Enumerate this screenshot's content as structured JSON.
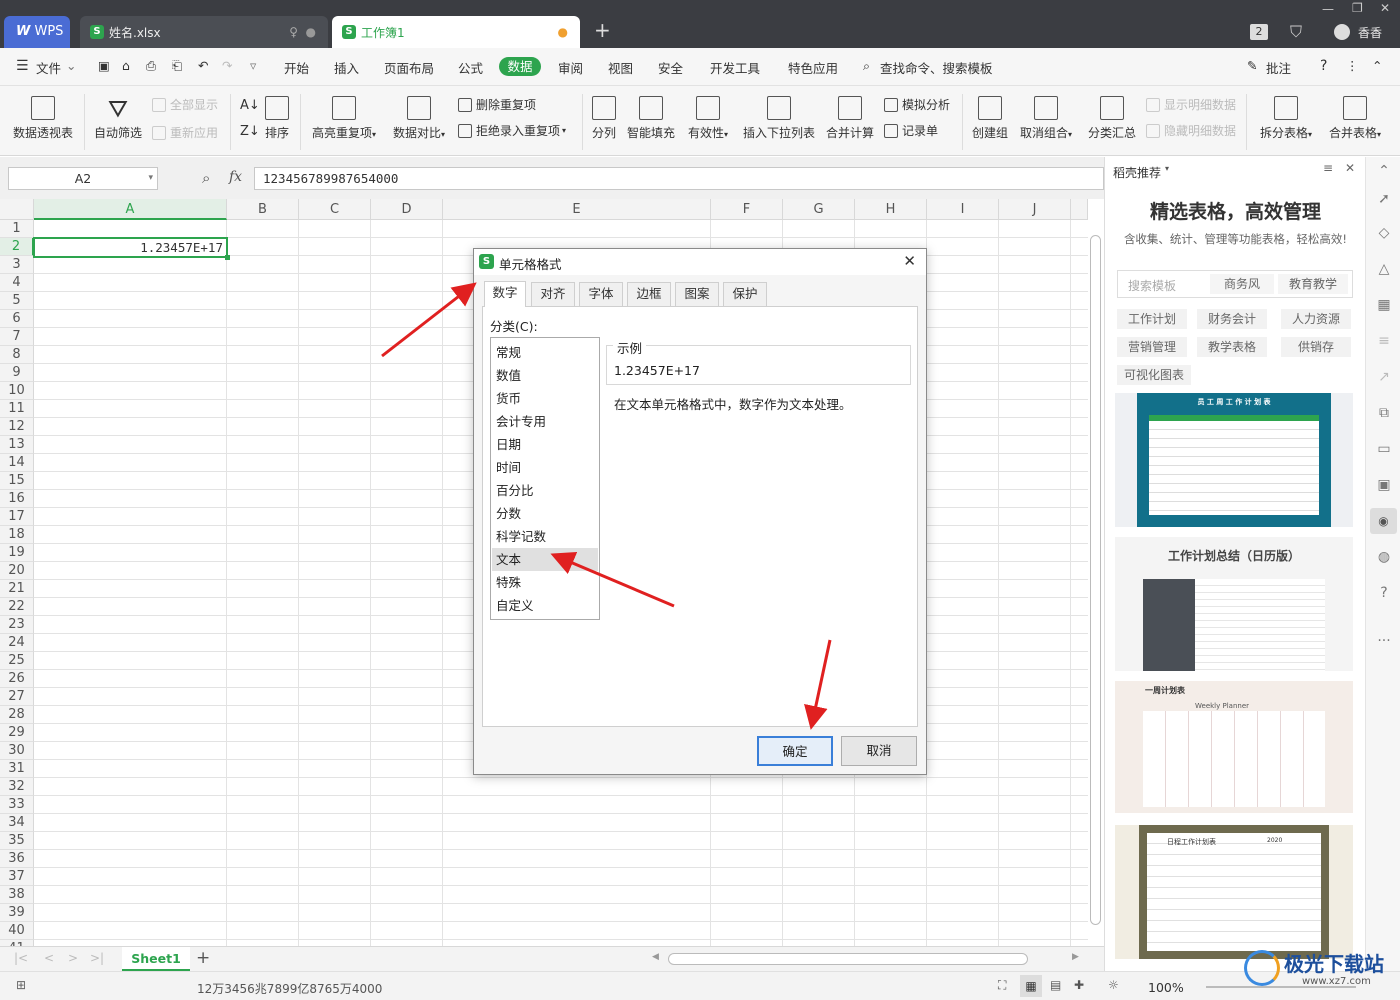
{
  "titlebar": {
    "app_label": "WPS",
    "tabs": [
      {
        "label": "姓名.xlsx"
      },
      {
        "label": "工作簿1"
      }
    ],
    "new_tab": "+",
    "page_count": "2",
    "user_name": "香香"
  },
  "menu": {
    "file": "文件",
    "items": [
      "开始",
      "插入",
      "页面布局",
      "公式",
      "数据",
      "审阅",
      "视图",
      "安全",
      "开发工具",
      "特色应用"
    ],
    "active": "数据",
    "search": "查找命令、搜索模板",
    "comment": "批注",
    "help": "?"
  },
  "ribbon": {
    "pivot": "数据透视表",
    "autofilter": "自动筛选",
    "show_all": "全部显示",
    "reapply": "重新应用",
    "sort": "排序",
    "highlight_dup": "高亮重复项",
    "compare": "数据对比",
    "remove_dup": "删除重复项",
    "reject_dup": "拒绝录入重复项",
    "split": "分列",
    "smart_fill": "智能填充",
    "validity": "有效性",
    "insert_dropdown": "插入下拉列表",
    "merge_calc": "合并计算",
    "simulate": "模拟分析",
    "record": "记录单",
    "create_group": "创建组",
    "ungroup": "取消组合",
    "subtotal": "分类汇总",
    "show_detail": "显示明细数据",
    "hide_detail": "隐藏明细数据",
    "split_table": "拆分表格",
    "merge_table": "合并表格"
  },
  "formula": {
    "namebox": "A2",
    "fx": "fx",
    "value": "123456789987654000"
  },
  "sheet": {
    "columns": [
      "A",
      "B",
      "C",
      "D",
      "E",
      "F",
      "G",
      "H",
      "I",
      "J"
    ],
    "rows": [
      "1",
      "2",
      "3",
      "4",
      "5",
      "6",
      "7",
      "8",
      "9",
      "10",
      "11",
      "12",
      "13",
      "14",
      "15",
      "16",
      "17",
      "18",
      "19",
      "20",
      "21",
      "22",
      "23",
      "24",
      "25",
      "26",
      "27",
      "28",
      "29",
      "30",
      "31",
      "32",
      "33",
      "34",
      "35",
      "36",
      "37",
      "38",
      "39",
      "40",
      "41"
    ],
    "a2_value": "1.23457E+17",
    "sheet_tab": "Sheet1",
    "add_sheet": "+"
  },
  "dialog": {
    "title": "单元格格式",
    "tabs": [
      "数字",
      "对齐",
      "字体",
      "边框",
      "图案",
      "保护"
    ],
    "active_tab": "数字",
    "category_label": "分类(C):",
    "categories": [
      "常规",
      "数值",
      "货币",
      "会计专用",
      "日期",
      "时间",
      "百分比",
      "分数",
      "科学记数",
      "文本",
      "特殊",
      "自定义"
    ],
    "selected_category": "文本",
    "sample_label": "示例",
    "sample_value": "1.23457E+17",
    "description": "在文本单元格格式中，数字作为文本处理。",
    "ok": "确定",
    "cancel": "取消"
  },
  "panel": {
    "header": "稻壳推荐",
    "title": "精选表格，高效管理",
    "subtitle": "含收集、统计、管理等功能表格，轻松高效!",
    "search_placeholder": "搜索模板",
    "tags_row1": [
      "商务风",
      "教育教学"
    ],
    "tags": [
      "工作计划",
      "财务会计",
      "人力资源",
      "营销管理",
      "教学表格",
      "供销存",
      "可视化图表"
    ],
    "t1_title": "员 工 周 工 作 计 划 表",
    "t2_title": "工作计划总结（日历版）",
    "t3_title": "一周计划表",
    "t3_sub": "Weekly  Planner",
    "t4_title": "日程工作计划表",
    "t4_year": "2020"
  },
  "status": {
    "text": "12万3456兆7899亿8765万4000",
    "zoom": "100%"
  },
  "watermark": "极光下载站",
  "watermark_url": "www.xz7.com",
  "colors": {
    "accent_green": "#2da44e",
    "arrow_red": "#e02020",
    "titlebar_bg": "#3b3d42"
  }
}
